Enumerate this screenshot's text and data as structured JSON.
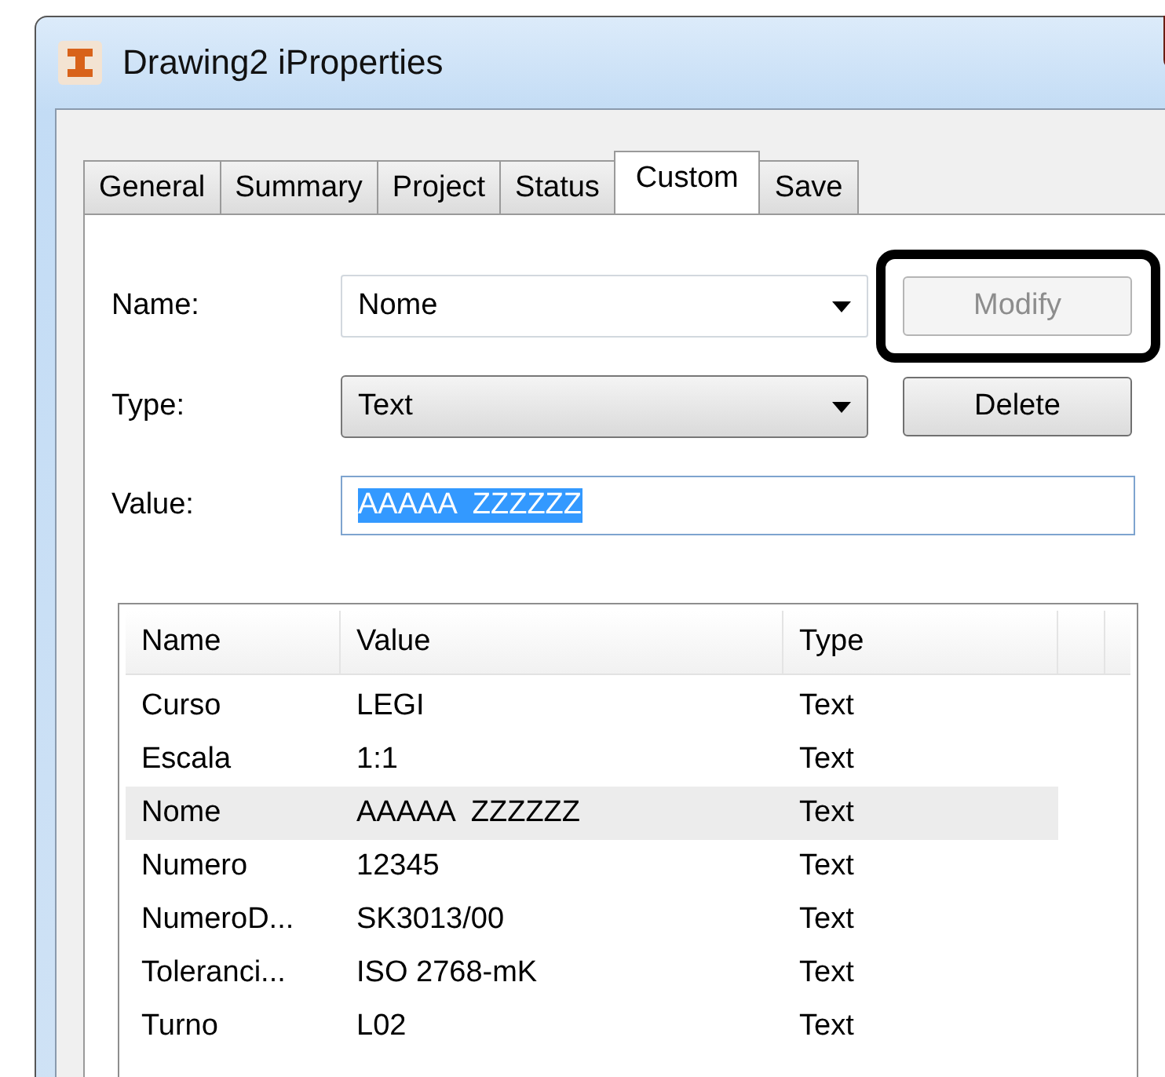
{
  "window": {
    "title": "Drawing2 iProperties"
  },
  "tabs": [
    {
      "label": "General",
      "selected": false
    },
    {
      "label": "Summary",
      "selected": false
    },
    {
      "label": "Project",
      "selected": false
    },
    {
      "label": "Status",
      "selected": false
    },
    {
      "label": "Custom",
      "selected": true
    },
    {
      "label": "Save",
      "selected": false
    }
  ],
  "form": {
    "name_label": "Name:",
    "name_value": "Nome",
    "type_label": "Type:",
    "type_value": "Text",
    "value_label": "Value:",
    "value_text": "AAAAA  ZZZZZZ",
    "value_selected": true
  },
  "buttons": [
    {
      "label": "Modify",
      "disabled": true,
      "highlighted": true
    },
    {
      "label": "Delete",
      "disabled": false,
      "highlighted": false
    }
  ],
  "table": {
    "columns": [
      "Name",
      "Value",
      "Type"
    ],
    "rows": [
      {
        "cells": [
          "Curso",
          "LEGI",
          "Text"
        ],
        "selected": false
      },
      {
        "cells": [
          "Escala",
          "1:1",
          "Text"
        ],
        "selected": false
      },
      {
        "cells": [
          "Nome",
          "AAAAA  ZZZZZZ",
          "Text"
        ],
        "selected": true
      },
      {
        "cells": [
          "Numero",
          "12345",
          "Text"
        ],
        "selected": false
      },
      {
        "cells": [
          "NumeroD...",
          "SK3013/00",
          "Text"
        ],
        "selected": false
      },
      {
        "cells": [
          "Toleranci...",
          "ISO 2768-mK",
          "Text"
        ],
        "selected": false
      },
      {
        "cells": [
          "Turno",
          "L02",
          "Text"
        ],
        "selected": false
      }
    ]
  }
}
